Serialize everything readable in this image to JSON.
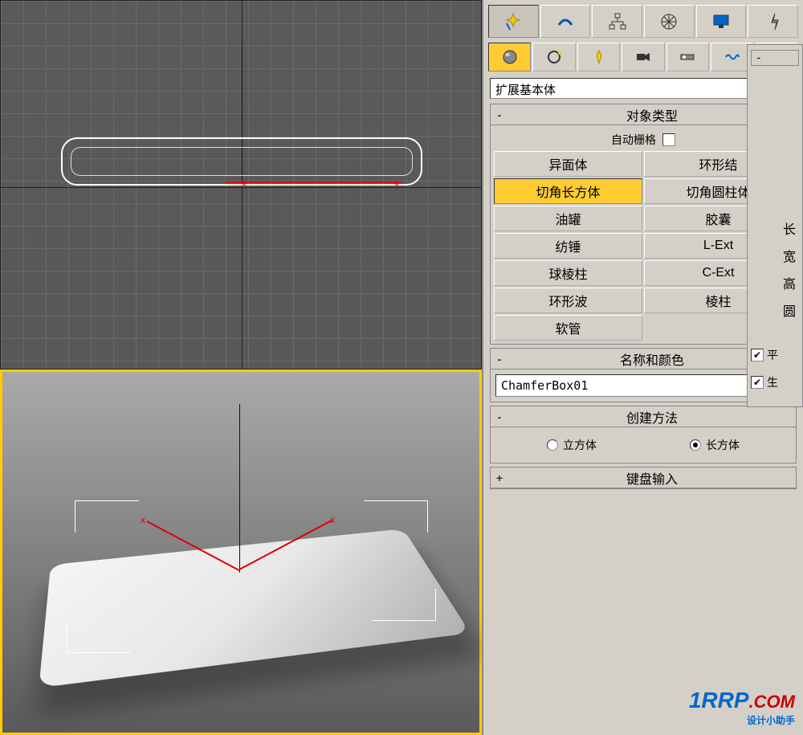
{
  "dropdown": {
    "value": "扩展基本体"
  },
  "rollouts": {
    "object_type": {
      "title": "对象类型",
      "toggle": "-",
      "auto_grid": "自动栅格"
    },
    "name_color": {
      "title": "名称和颜色",
      "toggle": "-"
    },
    "create_method": {
      "title": "创建方法",
      "toggle": "-",
      "cube": "立方体",
      "cuboid": "长方体"
    },
    "keyboard": {
      "title": "键盘输入",
      "toggle": "+"
    }
  },
  "types": {
    "hedra": "异面体",
    "torus_knot": "环形结",
    "chamfer_box": "切角长方体",
    "chamfer_cyl": "切角圆柱体",
    "oil_tank": "油罐",
    "capsule": "胶囊",
    "spindle": "纺锤",
    "l_ext": "L-Ext",
    "gengon": "球棱柱",
    "c_ext": "C-Ext",
    "ring_wave": "环形波",
    "prism": "棱柱",
    "hose": "软管"
  },
  "name_field": {
    "value": "ChamferBox01"
  },
  "params": {
    "length": "长",
    "width": "宽",
    "height": "高",
    "fillet": "圆",
    "smooth": "平",
    "gen": "生"
  },
  "gizmo": {
    "x": "x"
  },
  "watermark": {
    "main": "1RRP",
    "ext": ".COM",
    "sub": "设计小助手"
  }
}
